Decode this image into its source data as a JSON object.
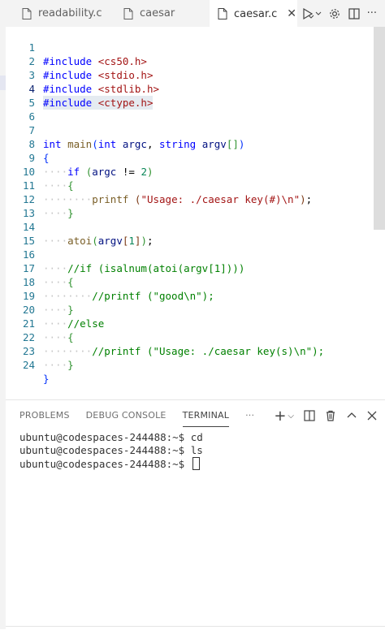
{
  "tabs": [
    {
      "label": "readability.c",
      "active": false
    },
    {
      "label": "caesar",
      "active": false
    },
    {
      "label": "caesar.c",
      "active": true
    }
  ],
  "icons": {
    "file": "file-icon",
    "close": "close-icon",
    "run": "run-icon",
    "settings": "gear-icon",
    "split": "split-editor-icon",
    "more": "more-icon"
  },
  "editor": {
    "active_line": 4,
    "lines": [
      {
        "n": "1"
      },
      {
        "n": "2"
      },
      {
        "n": "3"
      },
      {
        "n": "4"
      },
      {
        "n": "5"
      },
      {
        "n": "6"
      },
      {
        "n": "7"
      },
      {
        "n": "8"
      },
      {
        "n": "9"
      },
      {
        "n": "10"
      },
      {
        "n": "11"
      },
      {
        "n": "12"
      },
      {
        "n": "13"
      },
      {
        "n": "14"
      },
      {
        "n": "15"
      },
      {
        "n": "16"
      },
      {
        "n": "17"
      },
      {
        "n": "18"
      },
      {
        "n": "19"
      },
      {
        "n": "20"
      },
      {
        "n": "21"
      },
      {
        "n": "22"
      },
      {
        "n": "23"
      },
      {
        "n": "24"
      }
    ],
    "tokens": {
      "inc": "#include",
      "h1": "<cs50.h>",
      "h2": "<stdio.h>",
      "h3": "<stdlib.h>",
      "h4": "<ctype.h>",
      "int": "int",
      "main": "main",
      "argc": "argc",
      "string": "string",
      "argv": "argv",
      "if": "if",
      "ne": "!=",
      "two": "2",
      "printf": "printf",
      "usage1": "\"Usage: ./caesar key(#)\\n\"",
      "atoi": "atoi",
      "one": "1",
      "c16": "//if (isalnum(atoi(argv[1])))",
      "c18": "//printf (\"good\\n\");",
      "c20": "//else",
      "c22": "//printf (\"Usage: ./caesar key(s)\\n\");"
    }
  },
  "panel": {
    "tabs": [
      "PROBLEMS",
      "DEBUG CONSOLE",
      "TERMINAL"
    ],
    "more": "···",
    "active_tab": "TERMINAL",
    "terminal_lines": [
      "ubuntu@codespaces-244488:~$ cd",
      "ubuntu@codespaces-244488:~$ ls",
      "ubuntu@codespaces-244488:~$ "
    ]
  },
  "colors": {
    "keyword": "#0000ff",
    "string": "#a31515",
    "comment": "#008000",
    "function": "#795e26",
    "variable": "#001080",
    "number": "#098658",
    "line_number": "#237893"
  }
}
